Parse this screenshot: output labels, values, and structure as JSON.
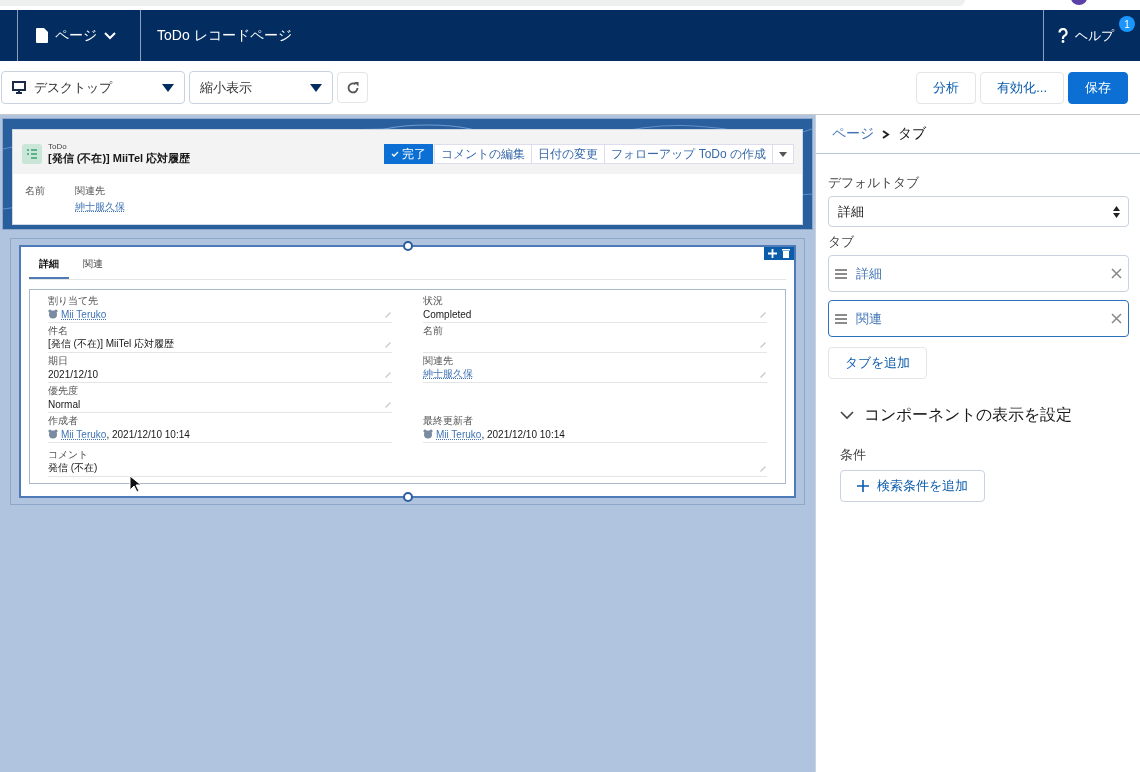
{
  "nav": {
    "page_menu": "ページ",
    "title": "ToDo レコードページ",
    "help": "ヘルプ",
    "help_badge": "1"
  },
  "toolbar": {
    "device": "デスクトップ",
    "view": "縮小表示",
    "buttons": [
      {
        "label": "分析",
        "kind": "neutral"
      },
      {
        "label": "有効化...",
        "kind": "neutral"
      },
      {
        "label": "保存",
        "kind": "brand"
      }
    ]
  },
  "record": {
    "object": "ToDo",
    "title": "[発信 (不在)] MiiTel 応対履歴",
    "actions": [
      {
        "label": "完了",
        "kind": "brand"
      },
      {
        "label": "コメントの編集",
        "kind": "neutral"
      },
      {
        "label": "日付の変更",
        "kind": "neutral"
      },
      {
        "label": "フォローアップ ToDo の作成",
        "kind": "neutral"
      }
    ],
    "highlights": [
      {
        "label": "名前"
      },
      {
        "label": "関連先",
        "value": "紳士服久保"
      }
    ]
  },
  "tabs": [
    {
      "label": "詳細",
      "selected": true
    },
    {
      "label": "関連",
      "selected": false
    }
  ],
  "fields": [
    {
      "left": {
        "label": "割り当て先",
        "kind": "user",
        "value": "Mii Teruko",
        "editable": true
      },
      "right": {
        "label": "状況",
        "kind": "text",
        "value": "Completed",
        "editable": true
      }
    },
    {
      "left": {
        "label": "件名",
        "kind": "text",
        "value": "[発信 (不在)] MiiTel 応対履歴",
        "editable": true
      },
      "right": {
        "label": "名前",
        "kind": "text",
        "editable": true
      }
    },
    {
      "left": {
        "label": "期日",
        "kind": "text",
        "value": "2021/12/10",
        "editable": true
      },
      "right": {
        "label": "関連先",
        "kind": "link",
        "value": "紳士服久保",
        "editable": true
      }
    },
    {
      "left": {
        "label": "優先度",
        "kind": "text",
        "value": "Normal",
        "editable": true
      }
    },
    {
      "left": {
        "label": "作成者",
        "kind": "user",
        "value": "Mii Teruko",
        "suffix": ", 2021/12/10 10:14",
        "editable": false
      },
      "right": {
        "label": "最終更新者",
        "kind": "user",
        "value": "Mii Teruko",
        "suffix": ", 2021/12/10 10:14",
        "editable": false
      }
    },
    {
      "left": {
        "label": "コメント",
        "kind": "text",
        "value": "発信 (不在)",
        "editable": true,
        "wide": true
      }
    }
  ],
  "panel": {
    "breadcrumb": [
      "ページ",
      "タブ"
    ],
    "default_tab_label": "デフォルトタブ",
    "default_tab": "詳細",
    "tabs_label": "タブ",
    "tab_items": [
      {
        "label": "詳細",
        "selected": false
      },
      {
        "label": "関連",
        "selected": true
      }
    ],
    "add_tab": "タブを追加",
    "section": {
      "title": "コンポーネントの表示を設定",
      "expanded": true
    },
    "conditions_label": "条件",
    "add_filter": "検索条件を追加"
  }
}
